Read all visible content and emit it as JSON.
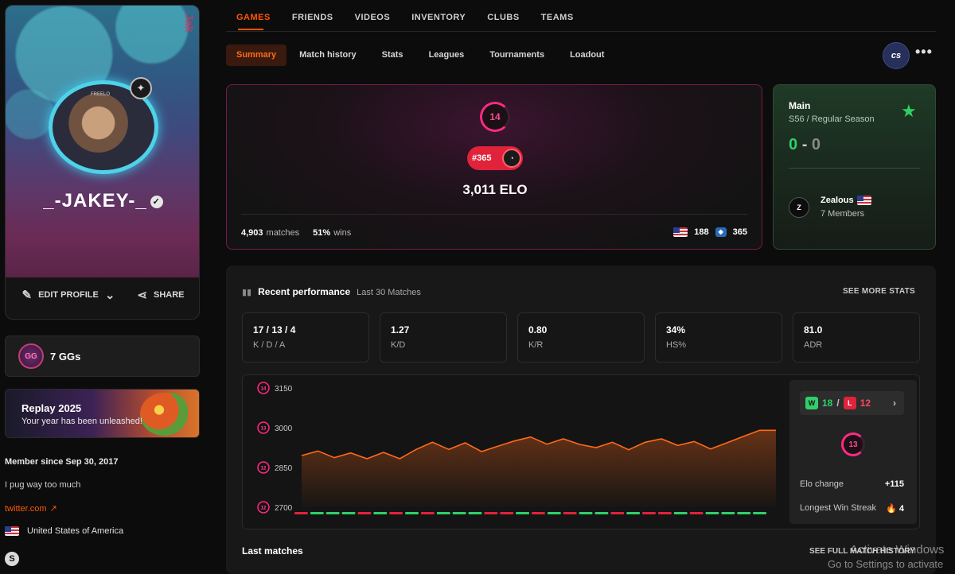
{
  "profile": {
    "username": "_-JAKEY-_",
    "avatar_label": "FREELO",
    "banner_tag": "Jak",
    "edit_profile": "EDIT PROFILE",
    "share": "SHARE"
  },
  "sidebar": {
    "ggs": "7 GGs",
    "gg_badge": "GG",
    "replay_title": "Replay 2025",
    "replay_sub": "Your year has been unleashed!",
    "member_since": "Member since Sep 30, 2017",
    "bio": "I pug way too much",
    "twitter": "twitter.com",
    "country": "United States of America"
  },
  "topnav": [
    "GAMES",
    "FRIENDS",
    "VIDEOS",
    "INVENTORY",
    "CLUBS",
    "TEAMS"
  ],
  "subnav": [
    "Summary",
    "Match history",
    "Stats",
    "Leagues",
    "Tournaments",
    "Loadout"
  ],
  "game_logo": "cs",
  "elo_card": {
    "level": "14",
    "rank": "#365",
    "elo": "3,011 ELO",
    "matches_value": "4,903",
    "matches_label": "matches",
    "winrate_value": "51%",
    "winrate_label": "wins",
    "country_rank": "188",
    "region_rank": "365"
  },
  "league": {
    "title": "Main",
    "season": "S56 / Regular Season",
    "wins": "0",
    "dash": "-",
    "losses": "0",
    "team_logo": "Z",
    "team_name": "Zealous",
    "team_members": "7 Members"
  },
  "performance": {
    "title": "Recent performance",
    "subtitle": "Last 30 Matches",
    "see_more": "SEE MORE STATS",
    "stats": [
      {
        "value": "17 / 13 / 4",
        "label": "K / D / A"
      },
      {
        "value": "1.27",
        "label": "K/D"
      },
      {
        "value": "0.80",
        "label": "K/R"
      },
      {
        "value": "34%",
        "label": "HS%"
      },
      {
        "value": "81.0",
        "label": "ADR"
      }
    ],
    "summary": {
      "wins": "18",
      "losses": "12",
      "level": "13",
      "elo_change_label": "Elo change",
      "elo_change": "+115",
      "streak_label": "Longest Win Streak",
      "streak": "4"
    },
    "last_matches": "Last matches",
    "full_history": "SEE FULL MATCH HISTORY"
  },
  "chart_data": {
    "type": "area",
    "y_ticks": [
      3150,
      3000,
      2850,
      2700
    ],
    "tick_levels": [
      "14",
      "13",
      "12",
      "12"
    ],
    "ylim": [
      2700,
      3150
    ],
    "x": [
      1,
      2,
      3,
      4,
      5,
      6,
      7,
      8,
      9,
      10,
      11,
      12,
      13,
      14,
      15,
      16,
      17,
      18,
      19,
      20,
      21,
      22,
      23,
      24,
      25,
      26,
      27,
      28,
      29,
      30
    ],
    "values": [
      2895,
      2912,
      2887,
      2905,
      2883,
      2907,
      2883,
      2918,
      2945,
      2918,
      2943,
      2910,
      2930,
      2950,
      2965,
      2938,
      2958,
      2937,
      2925,
      2945,
      2917,
      2945,
      2958,
      2933,
      2948,
      2920,
      2943,
      2967,
      2990,
      2990
    ],
    "results": [
      "L",
      "W",
      "W",
      "W",
      "L",
      "W",
      "L",
      "W",
      "L",
      "W",
      "W",
      "W",
      "L",
      "L",
      "W",
      "L",
      "W",
      "L",
      "W",
      "W",
      "L",
      "W",
      "L",
      "L",
      "W",
      "L",
      "W",
      "W",
      "W",
      "W"
    ],
    "colors": {
      "line": "#ff6a1a",
      "win": "#2fd06a",
      "loss": "#e0233a"
    }
  },
  "watermark": {
    "line1": "Activate Windows",
    "line2": "Go to Settings to activate Windows."
  }
}
